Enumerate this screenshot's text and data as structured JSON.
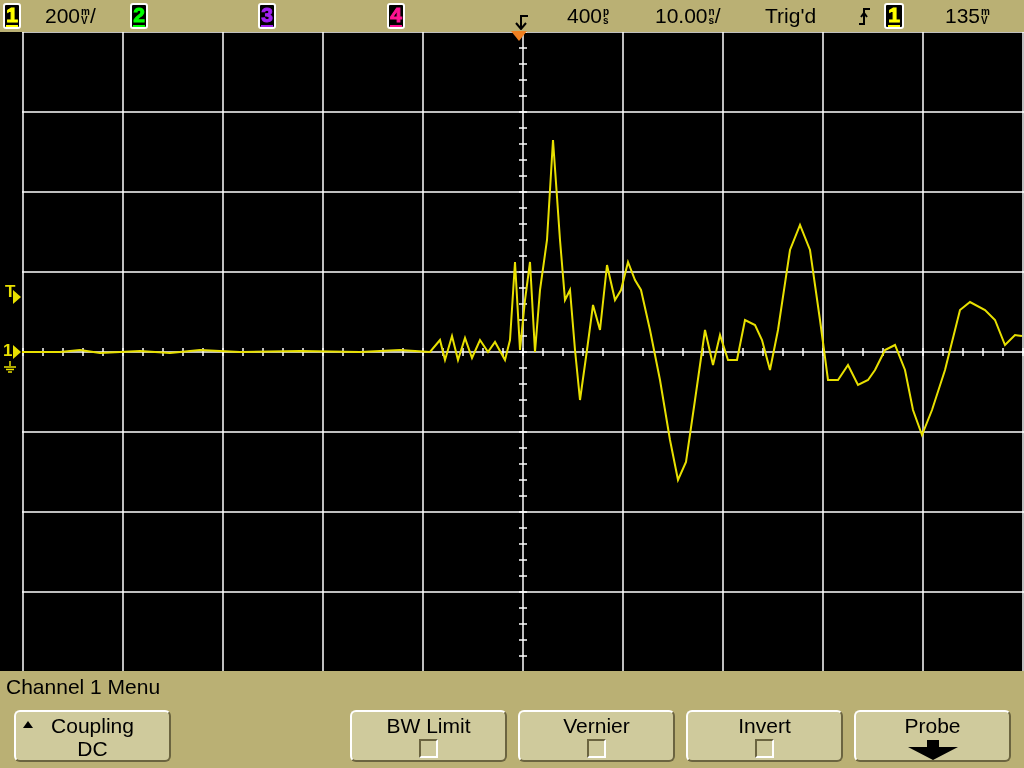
{
  "status_bar": {
    "channels": [
      {
        "number": "1",
        "color": "#ffff00",
        "scale": {
          "value": "200",
          "unit_top": "m",
          "unit_bottom": "V",
          "suffix": "/"
        }
      },
      {
        "number": "2",
        "color": "#00ff00"
      },
      {
        "number": "3",
        "color": "#a020f0"
      },
      {
        "number": "4",
        "color": "#ff1493"
      }
    ],
    "delay": {
      "value": "400",
      "unit_top": "p",
      "unit_bottom": "s"
    },
    "timebase": {
      "value": "10.00",
      "unit_top": "n",
      "unit_bottom": "s",
      "suffix": "/"
    },
    "trigger_status": "Trig'd",
    "trigger_source": {
      "number": "1",
      "color": "#ffff00"
    },
    "trigger_level": {
      "value": "135",
      "unit_top": "m",
      "unit_bottom": "V"
    }
  },
  "display": {
    "trigger_marker": "T",
    "channel_marker": "1"
  },
  "menu": {
    "title": "Channel 1 Menu",
    "softkeys": [
      {
        "kind": "value",
        "label": "Coupling",
        "value": "DC"
      },
      {
        "kind": "blank"
      },
      {
        "kind": "checkbox",
        "label": "BW Limit",
        "checked": false
      },
      {
        "kind": "checkbox",
        "label": "Vernier",
        "checked": false
      },
      {
        "kind": "checkbox",
        "label": "Invert",
        "checked": false
      },
      {
        "kind": "submenu",
        "label": "Probe"
      }
    ]
  }
}
